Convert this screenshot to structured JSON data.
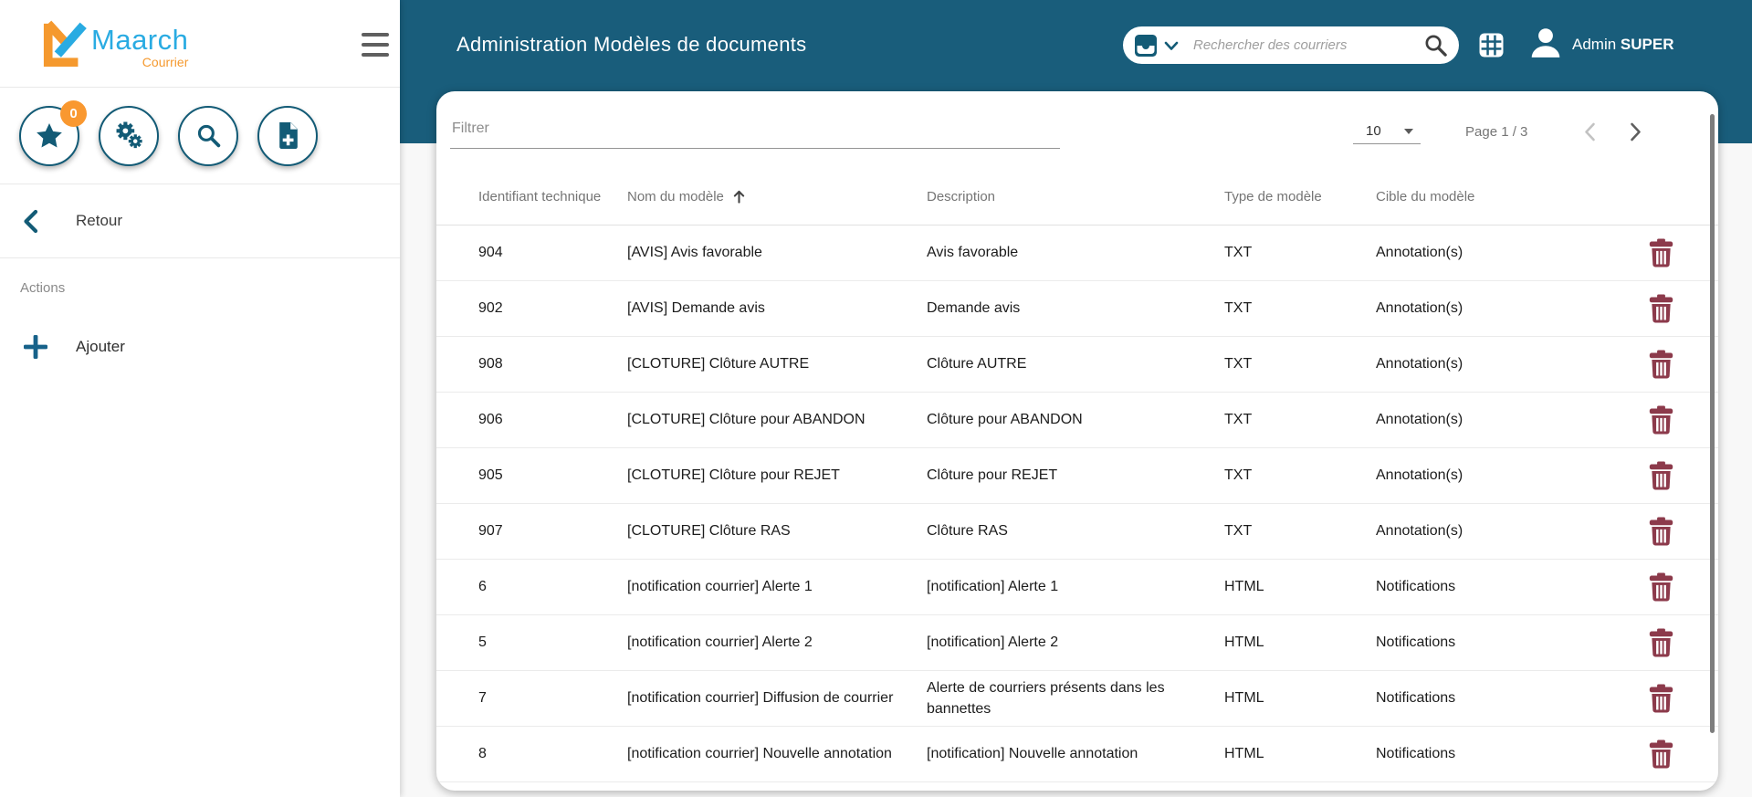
{
  "sidebar": {
    "logo": {
      "brand": "Maarch",
      "product": "Courrier"
    },
    "favorites_badge": "0",
    "back_label": "Retour",
    "section_label": "Actions",
    "add_label": "Ajouter"
  },
  "header": {
    "title": "Administration Modèles de documents",
    "search_placeholder": "Rechercher des courriers",
    "user_first": "Admin ",
    "user_last": "SUPER"
  },
  "toolbar": {
    "filter_placeholder": "Filtrer",
    "page_size": "10",
    "page_label": "Page 1 / 3"
  },
  "table": {
    "columns": [
      "Identifiant technique",
      "Nom du modèle",
      "Description",
      "Type de modèle",
      "Cible du modèle"
    ],
    "sorted_column": "Nom du modèle",
    "rows": [
      {
        "id": "904",
        "name": "[AVIS] Avis favorable",
        "description": "Avis favorable",
        "type": "TXT",
        "target": "Annotation(s)"
      },
      {
        "id": "902",
        "name": "[AVIS] Demande avis",
        "description": "Demande avis",
        "type": "TXT",
        "target": "Annotation(s)"
      },
      {
        "id": "908",
        "name": "[CLOTURE] Clôture AUTRE",
        "description": "Clôture AUTRE",
        "type": "TXT",
        "target": "Annotation(s)"
      },
      {
        "id": "906",
        "name": "[CLOTURE] Clôture pour ABANDON",
        "description": "Clôture pour ABANDON",
        "type": "TXT",
        "target": "Annotation(s)"
      },
      {
        "id": "905",
        "name": "[CLOTURE] Clôture pour REJET",
        "description": "Clôture pour REJET",
        "type": "TXT",
        "target": "Annotation(s)"
      },
      {
        "id": "907",
        "name": "[CLOTURE] Clôture RAS",
        "description": "Clôture RAS",
        "type": "TXT",
        "target": "Annotation(s)"
      },
      {
        "id": "6",
        "name": "[notification courrier] Alerte 1",
        "description": "[notification] Alerte 1",
        "type": "HTML",
        "target": "Notifications"
      },
      {
        "id": "5",
        "name": "[notification courrier] Alerte 2",
        "description": "[notification] Alerte 2",
        "type": "HTML",
        "target": "Notifications"
      },
      {
        "id": "7",
        "name": "[notification courrier] Diffusion de courrier",
        "description": "Alerte de courriers présents dans les bannettes",
        "type": "HTML",
        "target": "Notifications"
      },
      {
        "id": "8",
        "name": "[notification courrier] Nouvelle annotation",
        "description": "[notification] Nouvelle annotation",
        "type": "HTML",
        "target": "Notifications"
      }
    ]
  },
  "colors": {
    "teal_band": "#195D7B",
    "icon_accent": "#135B76",
    "badge_orange": "#F99830",
    "logo_blue": "#29ABE2",
    "logo_orange": "#F5992E",
    "trash_red": "#8C3A4B"
  }
}
